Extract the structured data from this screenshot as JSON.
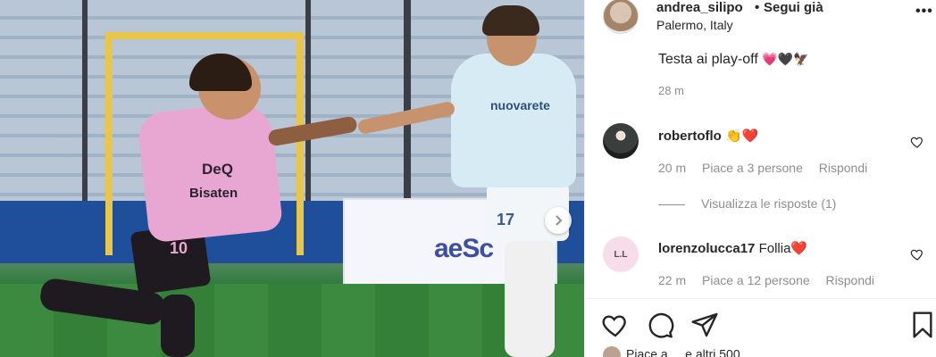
{
  "post": {
    "user": "andrea_silipo",
    "dot": "•",
    "follow_label": "Segui già",
    "location": "Palermo, Italy",
    "more_label": "•••",
    "caption_text": "Testa ai play-off",
    "caption_emojis": "💗🖤🦅",
    "caption_time": "28 m"
  },
  "photo": {
    "player1_number": "10",
    "player1_sponsor": "DeQ",
    "player1_sponsor2": "Bisaten",
    "player2_number": "17",
    "player2_sponsor": "nuovarete",
    "board_text": "aeSc",
    "next_icon": "chevron-right-icon"
  },
  "comments": [
    {
      "user": "robertoflo",
      "text": "👏❤️",
      "time": "20 m",
      "likes": "Piace a 3 persone",
      "reply": "Rispondi"
    },
    {
      "user": "lorenzolucca17",
      "text": "Follia❤️",
      "time": "22 m",
      "likes": "Piace a 12 persone",
      "reply": "Rispondi",
      "avatar_text": "L.L"
    }
  ],
  "replies_label": "Visualizza le risposte (1)",
  "likes_row_text": "Piace a ... e altri 500",
  "icons": {
    "like": "heart-icon",
    "comment": "comment-icon",
    "share": "send-icon",
    "save": "bookmark-icon"
  },
  "colors": {
    "text": "#262626",
    "secondary": "#8e8e8e",
    "heart_red": "#ed4956",
    "jersey_pink": "#e8a7d2"
  }
}
